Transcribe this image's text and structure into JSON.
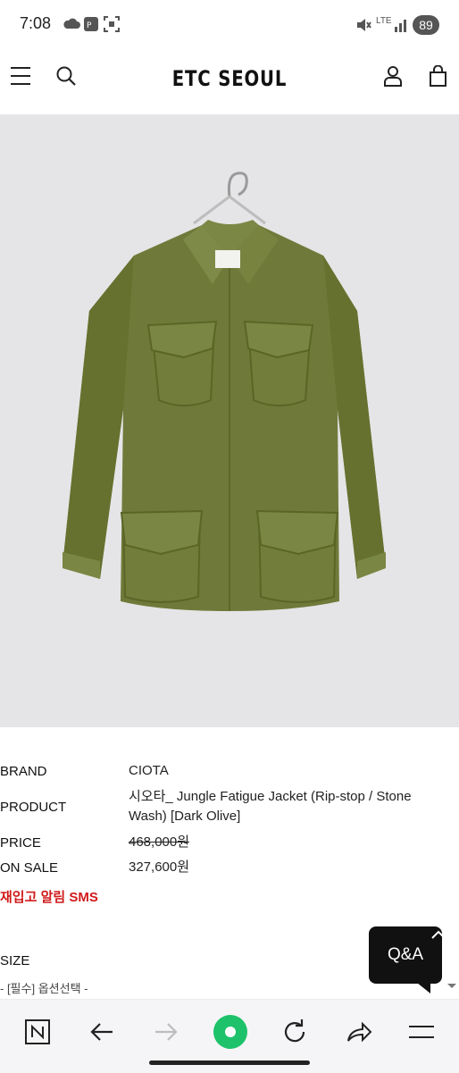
{
  "status_bar": {
    "time": "7:08",
    "network": "LTE",
    "battery": "89"
  },
  "header": {
    "title": "ETC SEOUL"
  },
  "product": {
    "brand_label": "BRAND",
    "brand_value": "CIOTA",
    "product_label": "PRODUCT",
    "product_line1": "시오타_ Jungle Fatigue Jacket (Rip-stop / Stone",
    "product_line2": "Wash) [Dark Olive]",
    "price_label": "PRICE",
    "price_value": "468,000원",
    "sale_label": "ON SALE",
    "sale_value": "327,600원",
    "restock_text": "재입고 알림 SMS",
    "size_label": "SIZE",
    "size_option": "- [필수] 옵션선택 -"
  },
  "qa_button": {
    "label": "Q&A"
  },
  "bottom_nav": {
    "items": [
      "naver-home-icon",
      "back-arrow-icon",
      "forward-arrow-icon",
      "green-dot-icon",
      "refresh-icon",
      "share-icon",
      "menu-icon"
    ]
  },
  "colors": {
    "jacket": "#6f7a3a",
    "background": "#e5e5e7",
    "sale_red": "#d11a1a",
    "green_button": "#1ec26b"
  }
}
